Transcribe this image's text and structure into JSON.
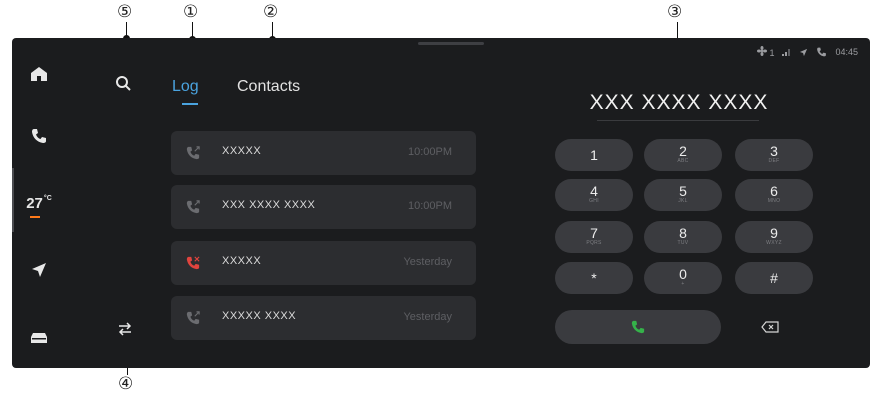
{
  "callouts": {
    "c1": "①",
    "c2": "②",
    "c3": "③",
    "c4": "④",
    "c5": "⑤"
  },
  "rail": {
    "items": [
      {
        "icon": "home-icon"
      },
      {
        "icon": "phone-icon"
      },
      {
        "icon": "climate-temperature",
        "temperature": "27",
        "unit": "°C"
      },
      {
        "icon": "navigation-arrow-icon"
      },
      {
        "icon": "car-icon"
      }
    ]
  },
  "tabs": {
    "log": "Log",
    "contacts": "Contacts",
    "active": "Log"
  },
  "status": {
    "fan": "1",
    "time": "04:45"
  },
  "dial": {
    "number": "XXX XXXX XXXX"
  },
  "log": [
    {
      "name": "XXXXX",
      "time": "10:00PM",
      "type": "outgoing"
    },
    {
      "name": "XXX XXXX XXXX",
      "time": "10:00PM",
      "type": "outgoing"
    },
    {
      "name": "XXXXX",
      "time": "Yesterday",
      "type": "missed"
    },
    {
      "name": "XXXXX XXXX",
      "time": "Yesterday",
      "type": "outgoing"
    }
  ],
  "keypad": [
    {
      "digit": "1",
      "letters": ""
    },
    {
      "digit": "2",
      "letters": "ABC"
    },
    {
      "digit": "3",
      "letters": "DEF"
    },
    {
      "digit": "4",
      "letters": "GHI"
    },
    {
      "digit": "5",
      "letters": "JKL"
    },
    {
      "digit": "6",
      "letters": "MNO"
    },
    {
      "digit": "7",
      "letters": "PQRS"
    },
    {
      "digit": "8",
      "letters": "TUV"
    },
    {
      "digit": "9",
      "letters": "WXYZ"
    },
    {
      "digit": "*",
      "letters": ""
    },
    {
      "digit": "0",
      "letters": "+"
    },
    {
      "digit": "#",
      "letters": ""
    }
  ],
  "colors": {
    "accent": "#4aa3df",
    "missed": "#e0443e",
    "background": "#1b1c1e",
    "key": "#3a3b3f",
    "call": "#35b24a"
  }
}
